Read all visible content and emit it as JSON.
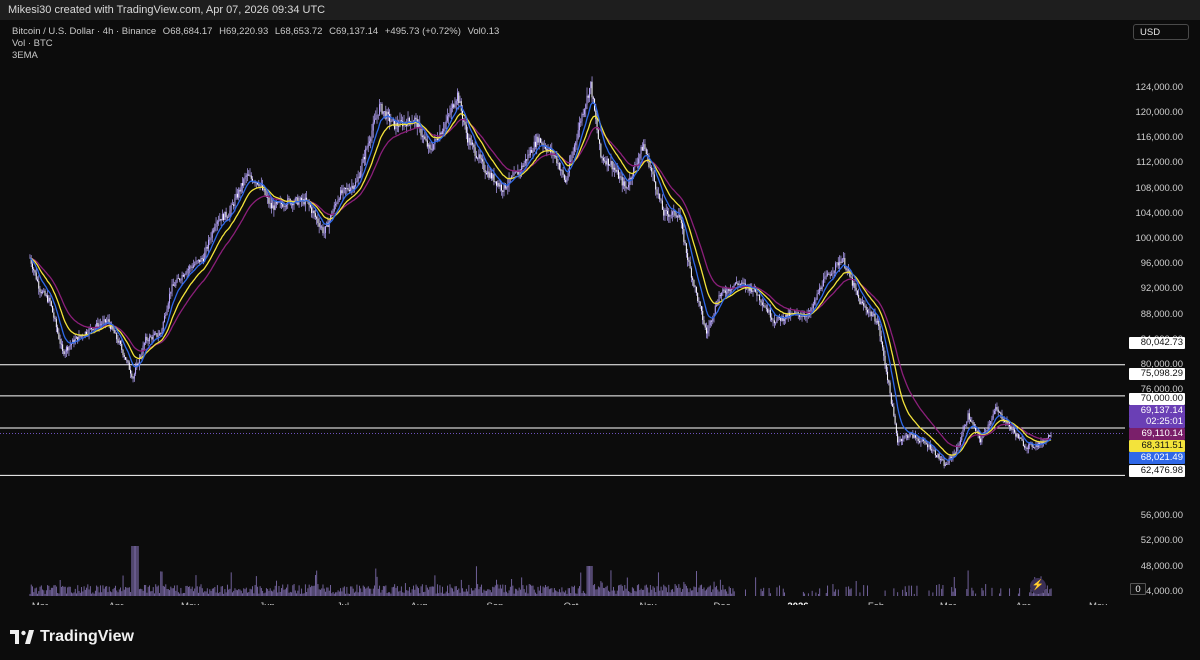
{
  "header": {
    "caption": "Mikesi30 created with TradingView.com, Apr 07, 2026 09:34 UTC"
  },
  "legend": {
    "symbol": "Bitcoin / U.S. Dollar · 4h · Binance",
    "o_label": "O",
    "o_value": "68,684.17",
    "h_label": "H",
    "h_value": "69,220.93",
    "l_label": "L",
    "l_value": "68,653.72",
    "c_label": "C",
    "c_value": "69,137.14",
    "change": "+495.73 (+0.72%)",
    "vol_label": "Vol",
    "vol_value": "0.13",
    "line2": "Vol · BTC",
    "line3": "3EMA"
  },
  "currency_button": "USD",
  "price_scale": [
    "124,000.00",
    "120,000.00",
    "116,000.00",
    "112,000.00",
    "108,000.00",
    "104,000.00",
    "100,000.00",
    "96,000.00",
    "92,000.00",
    "88,000.00",
    "84,000.00",
    "80,000.00",
    "76,000.00",
    "72,000.00",
    "56,000.00",
    "52,000.00",
    "48,000.00",
    "44,000.00"
  ],
  "time_scale": [
    "Mar",
    "Apr",
    "May",
    "Jun",
    "Jul",
    "Aug",
    "Sep",
    "Oct",
    "Nov",
    "Dec",
    "2026",
    "Feb",
    "Mar",
    "Apr",
    "May"
  ],
  "price_tags": {
    "level_1": "80,042.73",
    "level_2": "75,098.29",
    "level_3": "70,000.00",
    "last_price": "69,137.14",
    "countdown": "02:25:01",
    "ema_slow": "69,110.14",
    "ema_mid": "68,311.51",
    "ema_fast": "68,021.49",
    "level_4": "62,476.98",
    "volume_zero": "0"
  },
  "brand": "TradingView",
  "colors": {
    "candles": "#b9a7ff",
    "ema_fast": "#2f68e8",
    "ema_mid": "#f3e33b",
    "ema_slow": "#8b1f7a",
    "level_lines": "#ffffff"
  },
  "chart_data": {
    "type": "line",
    "series_type": "candlestick 4h with 3 EMAs",
    "x_labels": [
      "Mar",
      "Apr",
      "May",
      "Jun",
      "Jul",
      "Aug",
      "Sep",
      "Oct",
      "Nov",
      "Dec",
      "2026",
      "Feb",
      "Mar",
      "Apr",
      "May"
    ],
    "y_range": [
      44000,
      126000
    ],
    "close_path": [
      {
        "x": "Feb 25",
        "y": 97000
      },
      {
        "x": "Mar 01",
        "y": 92000
      },
      {
        "x": "Mar 05",
        "y": 90000
      },
      {
        "x": "Mar 10",
        "y": 82000
      },
      {
        "x": "Mar 15",
        "y": 84000
      },
      {
        "x": "Mar 22",
        "y": 86000
      },
      {
        "x": "Mar 28",
        "y": 87000
      },
      {
        "x": "Apr 02",
        "y": 83000
      },
      {
        "x": "Apr 07",
        "y": 78000
      },
      {
        "x": "Apr 12",
        "y": 84000
      },
      {
        "x": "Apr 18",
        "y": 85000
      },
      {
        "x": "Apr 22",
        "y": 92000
      },
      {
        "x": "Apr 28",
        "y": 95000
      },
      {
        "x": "May 05",
        "y": 97000
      },
      {
        "x": "May 10",
        "y": 103000
      },
      {
        "x": "May 15",
        "y": 104000
      },
      {
        "x": "May 22",
        "y": 110000
      },
      {
        "x": "May 27",
        "y": 109000
      },
      {
        "x": "Jun 01",
        "y": 105000
      },
      {
        "x": "Jun 08",
        "y": 106000
      },
      {
        "x": "Jun 15",
        "y": 106000
      },
      {
        "x": "Jun 22",
        "y": 101000
      },
      {
        "x": "Jun 28",
        "y": 107000
      },
      {
        "x": "Jul 05",
        "y": 109000
      },
      {
        "x": "Jul 10",
        "y": 116000
      },
      {
        "x": "Jul 14",
        "y": 121000
      },
      {
        "x": "Jul 20",
        "y": 118000
      },
      {
        "x": "Jul 28",
        "y": 119000
      },
      {
        "x": "Aug 03",
        "y": 114000
      },
      {
        "x": "Aug 10",
        "y": 119000
      },
      {
        "x": "Aug 14",
        "y": 123000
      },
      {
        "x": "Aug 18",
        "y": 116000
      },
      {
        "x": "Aug 25",
        "y": 111000
      },
      {
        "x": "Sep 01",
        "y": 108000
      },
      {
        "x": "Sep 08",
        "y": 111000
      },
      {
        "x": "Sep 15",
        "y": 116000
      },
      {
        "x": "Sep 22",
        "y": 113000
      },
      {
        "x": "Sep 26",
        "y": 109000
      },
      {
        "x": "Oct 02",
        "y": 119000
      },
      {
        "x": "Oct 06",
        "y": 124500
      },
      {
        "x": "Oct 10",
        "y": 113000
      },
      {
        "x": "Oct 14",
        "y": 112000
      },
      {
        "x": "Oct 20",
        "y": 108000
      },
      {
        "x": "Oct 27",
        "y": 115000
      },
      {
        "x": "Nov 04",
        "y": 104000
      },
      {
        "x": "Nov 10",
        "y": 104000
      },
      {
        "x": "Nov 14",
        "y": 96000
      },
      {
        "x": "Nov 21",
        "y": 85000
      },
      {
        "x": "Nov 26",
        "y": 91000
      },
      {
        "x": "Dec 03",
        "y": 93000
      },
      {
        "x": "Dec 10",
        "y": 92000
      },
      {
        "x": "Dec 18",
        "y": 87000
      },
      {
        "x": "Dec 25",
        "y": 88000
      },
      {
        "x": "Jan 01",
        "y": 88000
      },
      {
        "x": "Jan 06",
        "y": 93000
      },
      {
        "x": "Jan 14",
        "y": 97000
      },
      {
        "x": "Jan 21",
        "y": 90000
      },
      {
        "x": "Jan 28",
        "y": 87000
      },
      {
        "x": "Feb 01",
        "y": 78000
      },
      {
        "x": "Feb 05",
        "y": 68000
      },
      {
        "x": "Feb 10",
        "y": 69000
      },
      {
        "x": "Feb 18",
        "y": 67000
      },
      {
        "x": "Feb 24",
        "y": 64000
      },
      {
        "x": "Mar 01",
        "y": 67000
      },
      {
        "x": "Mar 05",
        "y": 72000
      },
      {
        "x": "Mar 10",
        "y": 68000
      },
      {
        "x": "Mar 16",
        "y": 73000
      },
      {
        "x": "Mar 22",
        "y": 70000
      },
      {
        "x": "Mar 28",
        "y": 67000
      },
      {
        "x": "Apr 03",
        "y": 67500
      },
      {
        "x": "Apr 07",
        "y": 69137
      }
    ],
    "horizontal_levels": [
      80042.73,
      75098.29,
      70000.0,
      62476.98
    ],
    "last_price": 69137.14
  }
}
